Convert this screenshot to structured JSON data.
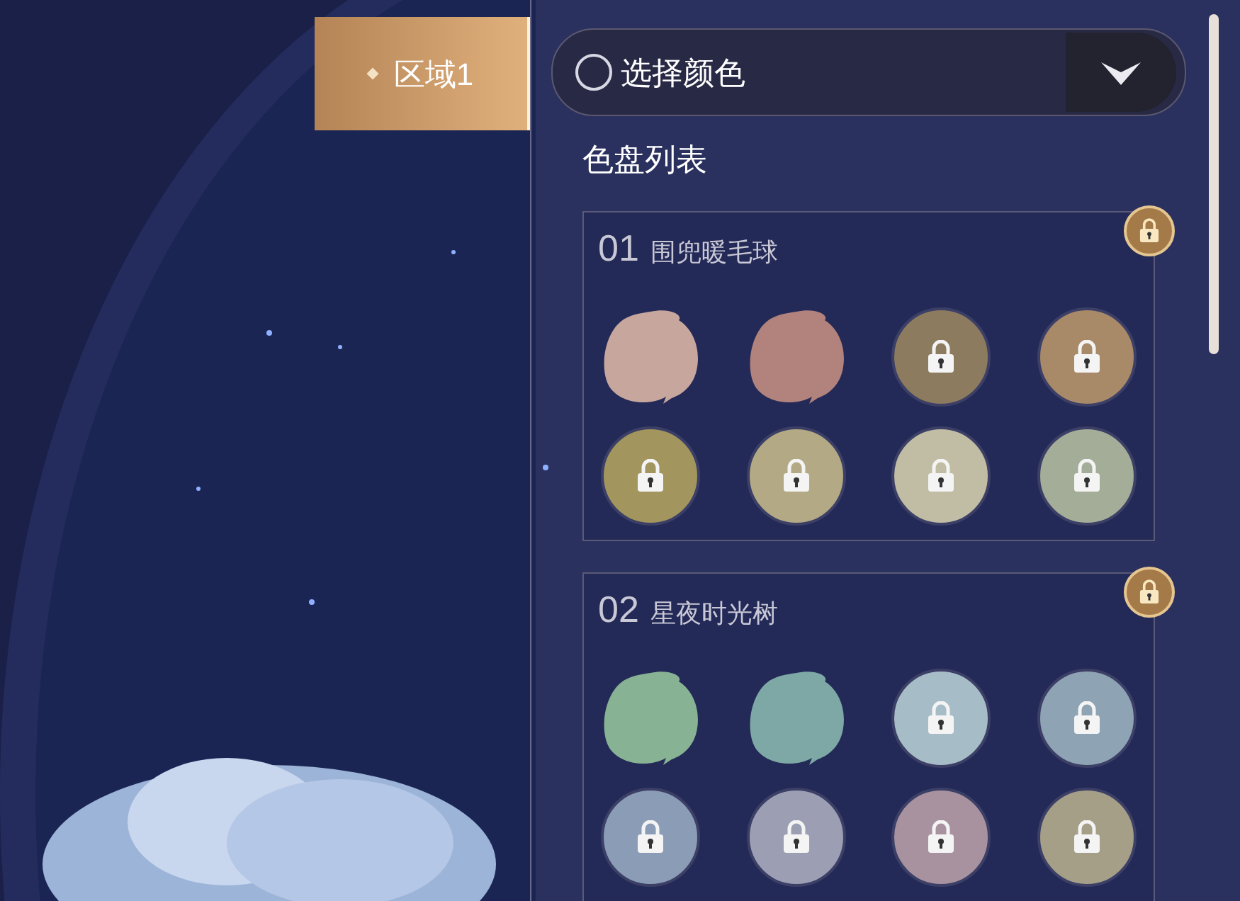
{
  "area_tab": {
    "label": "区域1",
    "selected": true
  },
  "color_select": {
    "label": "选择颜色"
  },
  "section_title": "色盘列表",
  "palettes": [
    {
      "number": "01",
      "name": "围兜暖毛球",
      "locked": true,
      "swatches": [
        {
          "color": "#c7a69e",
          "locked": false
        },
        {
          "color": "#b2827c",
          "locked": false
        },
        {
          "color": "#8c7b5e",
          "locked": true
        },
        {
          "color": "#a88968",
          "locked": true
        },
        {
          "color": "#a2955e",
          "locked": true
        },
        {
          "color": "#b3a984",
          "locked": true
        },
        {
          "color": "#c0bda4",
          "locked": true
        },
        {
          "color": "#a4ad98",
          "locked": true
        }
      ]
    },
    {
      "number": "02",
      "name": "星夜时光树",
      "locked": true,
      "swatches": [
        {
          "color": "#87b294",
          "locked": false
        },
        {
          "color": "#7ea8a5",
          "locked": false
        },
        {
          "color": "#a6bcc7",
          "locked": true
        },
        {
          "color": "#8ea3b4",
          "locked": true
        },
        {
          "color": "#8b9cb6",
          "locked": true
        },
        {
          "color": "#9c9fb3",
          "locked": true
        },
        {
          "color": "#a892a0",
          "locked": true
        },
        {
          "color": "#a69f88",
          "locked": true
        }
      ]
    }
  ]
}
